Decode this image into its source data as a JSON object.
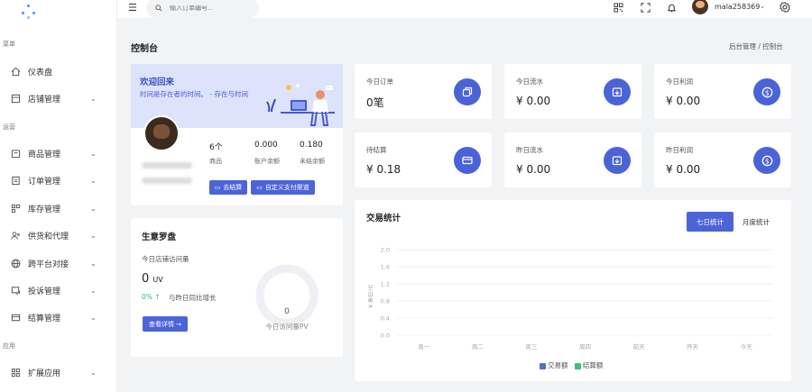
{
  "sidebar": {
    "groups": [
      "菜单",
      "运营",
      "应用"
    ],
    "items": [
      {
        "label": "仪表盘",
        "icon": "home-icon",
        "chevron": ""
      },
      {
        "label": "店铺管理",
        "icon": "store-icon",
        "chevron": "⌄"
      },
      {
        "label": "商品管理",
        "icon": "goods-icon",
        "chevron": "⌄"
      },
      {
        "label": "订单管理",
        "icon": "order-icon",
        "chevron": "⌄"
      },
      {
        "label": "库存管理",
        "icon": "inventory-icon",
        "chevron": "⌄"
      },
      {
        "label": "供货和代理",
        "icon": "supplier-icon",
        "chevron": "⌄"
      },
      {
        "label": "跨平台对接",
        "icon": "globe-icon",
        "chevron": "⌄"
      },
      {
        "label": "投诉管理",
        "icon": "complaint-icon",
        "chevron": "⌄"
      },
      {
        "label": "结算管理",
        "icon": "settlement-icon",
        "chevron": "⌄"
      },
      {
        "label": "扩展应用",
        "icon": "apps-icon",
        "chevron": "⌄"
      }
    ]
  },
  "topbar": {
    "search_placeholder": "输入订单编号...",
    "username": "mala258369",
    "chevron": "⌄",
    "icons": [
      "qrcode-icon",
      "fullscreen-icon",
      "bell-icon",
      "settings-icon"
    ]
  },
  "page": {
    "title": "控制台",
    "breadcrumb": "后台管理 / 控制台"
  },
  "welcome": {
    "title": "欢迎回来",
    "desc": "时间是存在者的时间。 - 存在与时间",
    "stats": [
      {
        "value": "6个",
        "label": "商品"
      },
      {
        "value": "0.000",
        "label": "账户余额"
      },
      {
        "value": "0.180",
        "label": "未结余额"
      }
    ],
    "btn_settle": "去结算",
    "btn_custom": "自定义支付渠道"
  },
  "metrics": [
    {
      "title": "今日订单",
      "value": "0笔",
      "icon": "order-box-icon"
    },
    {
      "title": "今日流水",
      "value": "¥ 0.00",
      "icon": "wallet-icon"
    },
    {
      "title": "今日利润",
      "value": "¥ 0.00",
      "icon": "coin-icon"
    },
    {
      "title": "待结算",
      "value": "¥ 0.18",
      "icon": "card-icon"
    },
    {
      "title": "昨日流水",
      "value": "¥ 0.00",
      "icon": "wallet-icon"
    },
    {
      "title": "昨日利润",
      "value": "¥ 0.00",
      "icon": "coin-icon"
    }
  ],
  "compass": {
    "title": "生意罗盘",
    "visits_label": "今日店铺访问量",
    "uv_value": "0",
    "uv_unit": "UV",
    "growth": "0% ↑",
    "growth_label": "与昨日同比增长",
    "detail_btn": "查看详情 →",
    "gauge_value": "0",
    "gauge_label": "今日访问量PV"
  },
  "trade": {
    "title": "交易统计",
    "tab_week": "七日统计",
    "tab_month": "月度统计",
    "legend": [
      {
        "name": "交易额",
        "color": "#5470c6"
      },
      {
        "name": "结算额",
        "color": "#36c27a"
      }
    ]
  },
  "chart_data": {
    "type": "line",
    "title": "",
    "xlabel": "",
    "ylabel": "¥ 单位:元",
    "categories": [
      "周一",
      "周二",
      "周三",
      "周四",
      "前天",
      "昨天",
      "今天"
    ],
    "ylim": [
      0,
      2.0
    ],
    "yticks": [
      "0.0",
      "0.4",
      "0.8",
      "1.2",
      "1.6",
      "2.0"
    ],
    "series": [
      {
        "name": "交易额",
        "values": [
          0,
          0,
          0,
          0,
          0,
          0,
          0
        ]
      },
      {
        "name": "结算额",
        "values": [
          0,
          0,
          0,
          0,
          0,
          0,
          0
        ]
      }
    ],
    "grid": true,
    "legend_position": "bottom"
  }
}
